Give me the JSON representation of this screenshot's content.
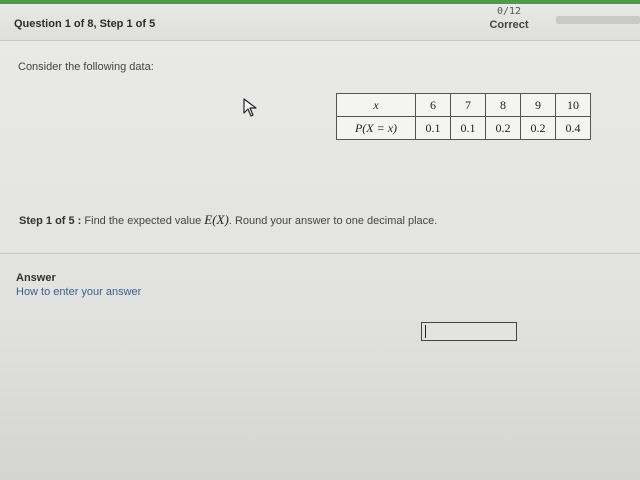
{
  "header": {
    "question_progress": "Question 1 of 8, Step 1 of 5",
    "score": "0/12",
    "status": "Correct"
  },
  "problem": {
    "prompt": "Consider the following data:",
    "table": {
      "row_x_label": "x",
      "row_p_label": "P(X = x)",
      "x_values": [
        "6",
        "7",
        "8",
        "9",
        "10"
      ],
      "p_values": [
        "0.1",
        "0.1",
        "0.2",
        "0.2",
        "0.4"
      ]
    },
    "step_label": "Step 1 of 5 :",
    "step_text_before": "Find the expected value",
    "step_math": "E(X)",
    "step_text_after": ". Round your answer to one decimal place."
  },
  "answer": {
    "label": "Answer",
    "help_link": "How to enter your answer",
    "value": ""
  },
  "colors": {
    "accent_green": "#4e9a4a",
    "link_blue": "#3a5f8a"
  }
}
